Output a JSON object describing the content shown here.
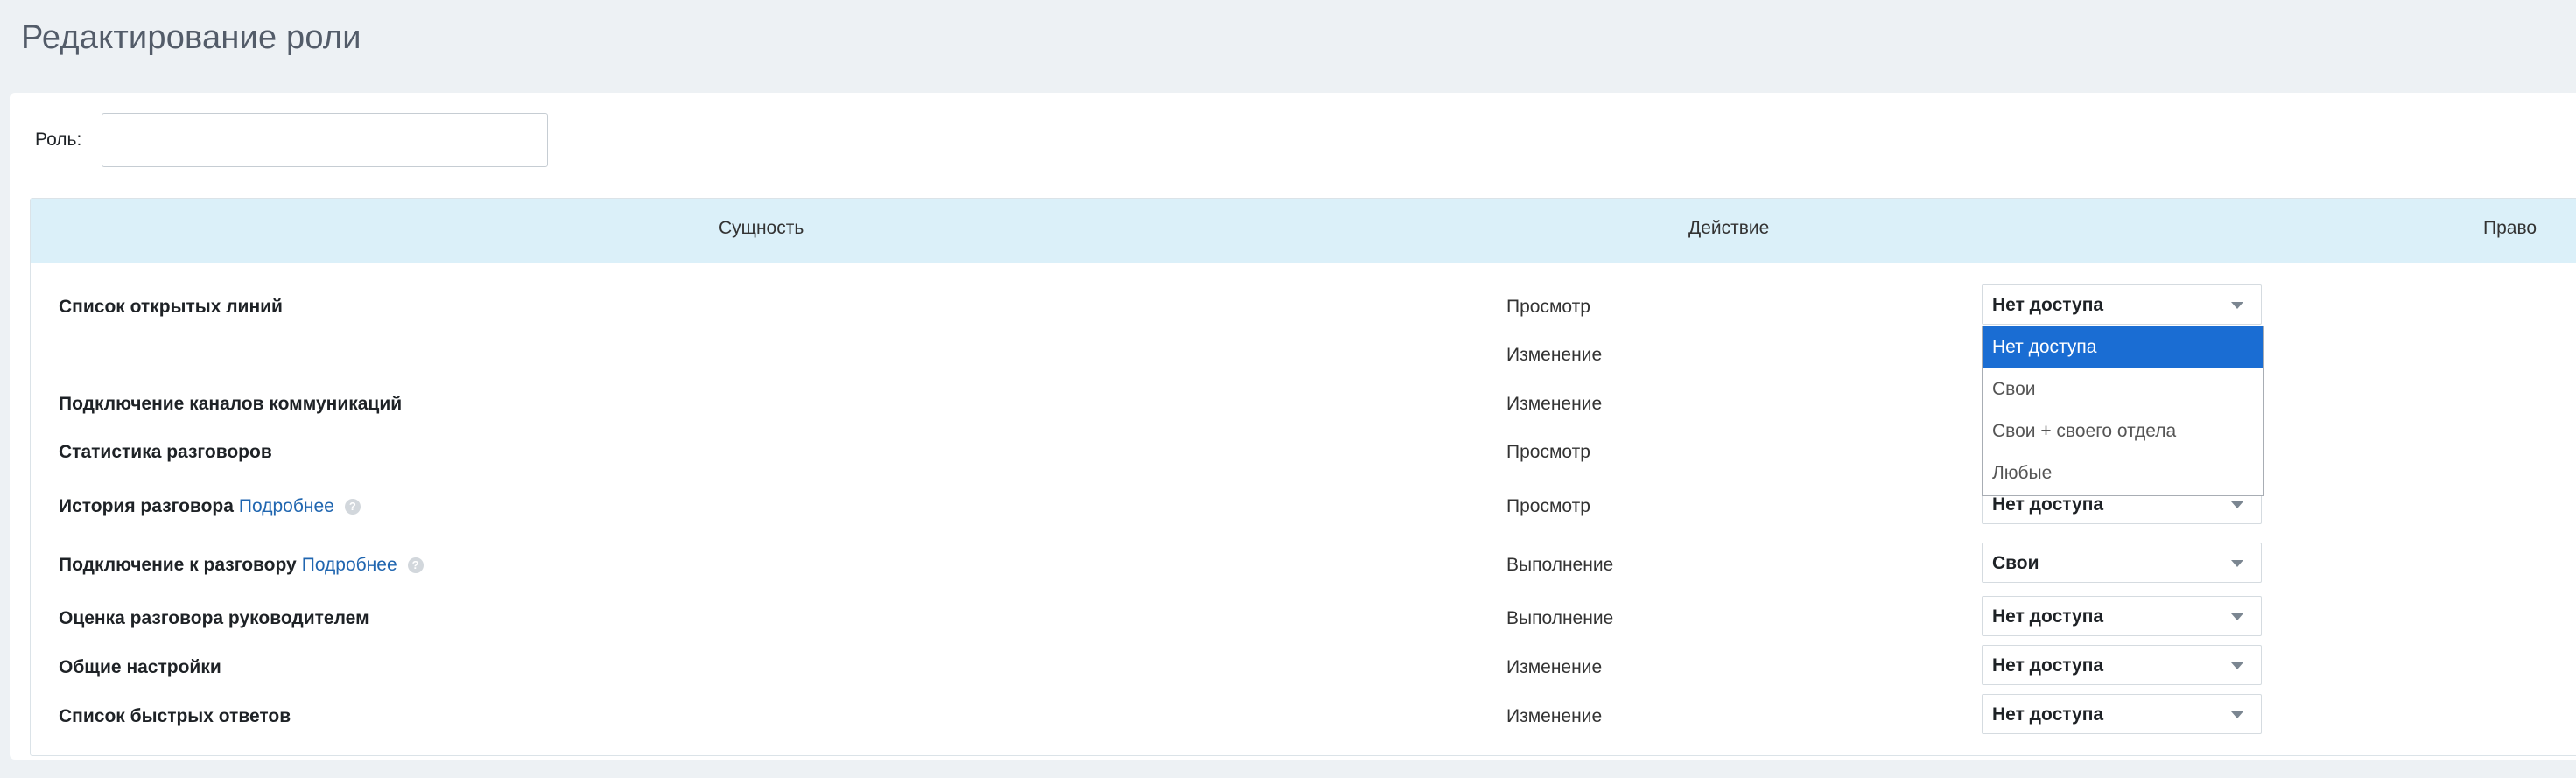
{
  "page": {
    "title": "Редактирование роли"
  },
  "role": {
    "label": "Роль:",
    "value": ""
  },
  "table": {
    "headers": {
      "entity": "Сущность",
      "action": "Действие",
      "right": "Право"
    },
    "rows": [
      {
        "entity": "Список открытых линий",
        "action": "Просмотр",
        "right": "Нет доступа"
      },
      {
        "entity": "",
        "action": "Изменение",
        "right": ""
      },
      {
        "entity": "Подключение каналов коммуникаций",
        "action": "Изменение",
        "right": ""
      },
      {
        "entity": "Статистика разговоров",
        "action": "Просмотр",
        "right": ""
      },
      {
        "entity": "История разговора",
        "link": "Подробнее",
        "action": "Просмотр",
        "right": "Нет доступа"
      },
      {
        "entity": "Подключение к разговору",
        "link": "Подробнее",
        "action": "Выполнение",
        "right": "Свои"
      },
      {
        "entity": "Оценка разговора руководителем",
        "action": "Выполнение",
        "right": "Нет доступа"
      },
      {
        "entity": "Общие настройки",
        "action": "Изменение",
        "right": "Нет доступа"
      },
      {
        "entity": "Список быстрых ответов",
        "action": "Изменение",
        "right": "Нет доступа"
      }
    ]
  },
  "dropdown": {
    "options": [
      "Нет доступа",
      "Свои",
      "Свои + своего отдела",
      "Любые"
    ],
    "selected": "Нет доступа"
  },
  "icons": {
    "help": "question-icon",
    "arrow": "chevron-down-icon"
  },
  "colors": {
    "header_bg": "#dbf0f9",
    "link": "#2066b0",
    "selected_option": "#1a6dd3",
    "page_bg": "#edf1f4"
  }
}
